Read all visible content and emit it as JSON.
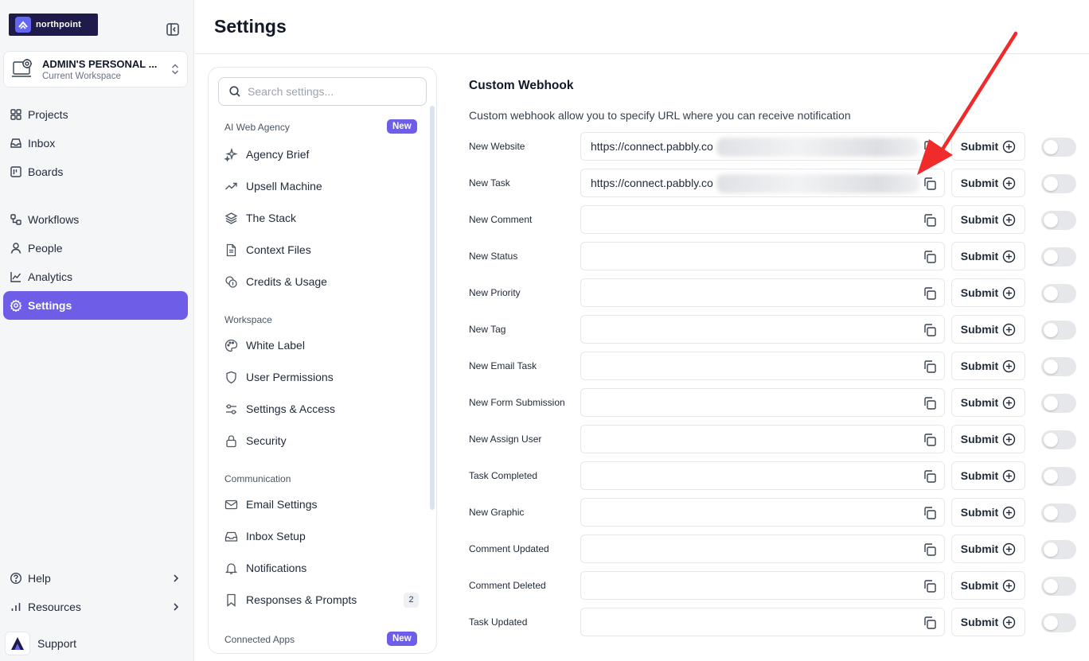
{
  "brand": {
    "name": "northpoint"
  },
  "workspace": {
    "name": "ADMIN'S PERSONAL ...",
    "subtitle": "Current Workspace"
  },
  "nav": {
    "items": [
      {
        "label": "Projects",
        "icon": "grid-icon"
      },
      {
        "label": "Inbox",
        "icon": "inbox-icon"
      },
      {
        "label": "Boards",
        "icon": "kanban-icon"
      },
      {
        "label": "Workflows",
        "icon": "workflow-icon"
      },
      {
        "label": "People",
        "icon": "person-icon"
      },
      {
        "label": "Analytics",
        "icon": "line-chart-icon"
      },
      {
        "label": "Settings",
        "icon": "gear-icon",
        "active": true
      }
    ],
    "bottom": [
      {
        "label": "Help",
        "icon": "help-circle-icon"
      },
      {
        "label": "Resources",
        "icon": "bar-chart-icon"
      }
    ],
    "support": "Support"
  },
  "page": {
    "title": "Settings"
  },
  "settings_menu": {
    "search_placeholder": "Search settings...",
    "sections": [
      {
        "label": "AI Web Agency",
        "badge": "New",
        "items": [
          "Agency Brief",
          "Upsell Machine",
          "The Stack",
          "Context Files",
          "Credits & Usage"
        ]
      },
      {
        "label": "Workspace",
        "items": [
          "White Label",
          "User Permissions",
          "Settings & Access",
          "Security"
        ]
      },
      {
        "label": "Communication",
        "items": [
          "Email Settings",
          "Inbox Setup",
          "Notifications",
          "Responses & Prompts"
        ],
        "responses_count": "2"
      },
      {
        "label": "Connected Apps",
        "badge": "New"
      }
    ]
  },
  "webhook": {
    "title": "Custom Webhook",
    "description": "Custom webhook allow you to specify URL where you can receive notification",
    "submit_label": "Submit",
    "rows": [
      {
        "label": "New Website",
        "value": "https://connect.pabbly.co"
      },
      {
        "label": "New Task",
        "value": "https://connect.pabbly.co"
      },
      {
        "label": "New Comment",
        "value": ""
      },
      {
        "label": "New Status",
        "value": ""
      },
      {
        "label": "New Priority",
        "value": ""
      },
      {
        "label": "New Tag",
        "value": ""
      },
      {
        "label": "New Email Task",
        "value": ""
      },
      {
        "label": "New Form Submission",
        "value": ""
      },
      {
        "label": "New Assign User",
        "value": ""
      },
      {
        "label": "Task Completed",
        "value": ""
      },
      {
        "label": "New Graphic",
        "value": ""
      },
      {
        "label": "Comment Updated",
        "value": ""
      },
      {
        "label": "Comment Deleted",
        "value": ""
      },
      {
        "label": "Task Updated",
        "value": ""
      }
    ]
  },
  "colors": {
    "accent": "#6d5de7",
    "arrow": "#ef2b2b"
  }
}
